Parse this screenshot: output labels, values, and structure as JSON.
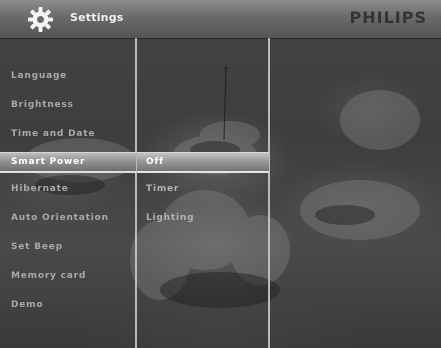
{
  "header": {
    "title": "Settings",
    "brand": "PHILIPS",
    "icon": "gear-icon"
  },
  "menu": {
    "items": [
      {
        "label": "Language",
        "selected": false
      },
      {
        "label": "Brightness",
        "selected": false
      },
      {
        "label": "Time and Date",
        "selected": false
      },
      {
        "label": "Smart Power",
        "selected": true
      },
      {
        "label": "Hibernate",
        "selected": false
      },
      {
        "label": "Auto Orientation",
        "selected": false
      },
      {
        "label": "Set Beep",
        "selected": false
      },
      {
        "label": "Memory card",
        "selected": false
      },
      {
        "label": "Demo",
        "selected": false
      }
    ]
  },
  "submenu": {
    "items": [
      {
        "label": "Off",
        "selected": true
      },
      {
        "label": "Timer",
        "selected": false
      },
      {
        "label": "Lighting",
        "selected": false
      }
    ]
  },
  "colors": {
    "selection": "#9a9a9a",
    "text": "#a9a9a9",
    "selected_text": "#ffffff",
    "divider": "#cfcfcf"
  }
}
